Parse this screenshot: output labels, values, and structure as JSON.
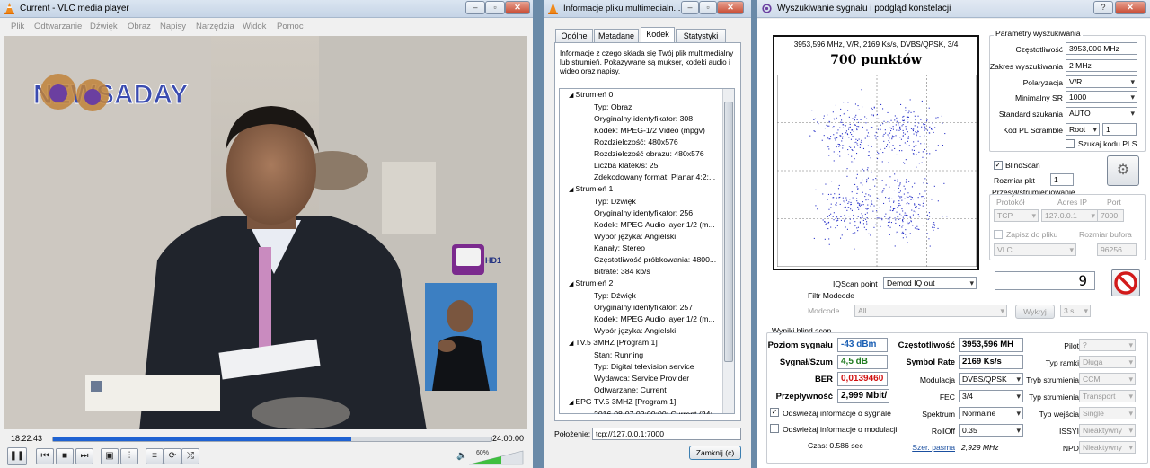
{
  "vlc": {
    "title": "Current - VLC media player",
    "menu": [
      "Plik",
      "Odtwarzanie",
      "Dźwięk",
      "Obraz",
      "Napisy",
      "Narzędzia",
      "Widok",
      "Pomoc"
    ],
    "overlay_logo": "NEWSADAY",
    "channel_logo": "HD1",
    "time_current": "18:22:43",
    "time_total": "24:00:00",
    "progress": 0.68,
    "volume": "60%",
    "volume_level": 0.6
  },
  "info": {
    "title": "Informacje pliku multimedialn...",
    "tabs": [
      "Ogólne",
      "Metadane",
      "Kodek",
      "Statystyki"
    ],
    "active_tab": "Kodek",
    "description": "Informacje z czego składa się Twój plik multimedialny lub strumień. Pokazywane są mukser, kodeki audio i wideo oraz napisy.",
    "tree": [
      {
        "t": "s",
        "text": "Strumień 0"
      },
      {
        "t": "c",
        "text": "Typ: Obraz"
      },
      {
        "t": "c",
        "text": "Oryginalny identyfikator: 308"
      },
      {
        "t": "c",
        "text": "Kodek: MPEG-1/2 Video (mpgv)"
      },
      {
        "t": "c",
        "text": "Rozdzielczość: 480x576"
      },
      {
        "t": "c",
        "text": "Rozdzielczość obrazu: 480x576"
      },
      {
        "t": "c",
        "text": "Liczba klatek/s: 25"
      },
      {
        "t": "c",
        "text": "Zdekodowany format: Planar 4:2:..."
      },
      {
        "t": "s",
        "text": "Strumień 1"
      },
      {
        "t": "c",
        "text": "Typ: Dźwięk"
      },
      {
        "t": "c",
        "text": "Oryginalny identyfikator: 256"
      },
      {
        "t": "c",
        "text": "Kodek: MPEG Audio layer 1/2 (m..."
      },
      {
        "t": "c",
        "text": "Wybór języka: Angielski"
      },
      {
        "t": "c",
        "text": "Kanały: Stereo"
      },
      {
        "t": "c",
        "text": "Częstotliwość próbkowania: 4800..."
      },
      {
        "t": "c",
        "text": "Bitrate: 384 kb/s"
      },
      {
        "t": "s",
        "text": "Strumień 2"
      },
      {
        "t": "c",
        "text": "Typ: Dźwięk"
      },
      {
        "t": "c",
        "text": "Oryginalny identyfikator: 257"
      },
      {
        "t": "c",
        "text": "Kodek: MPEG Audio layer 1/2 (m..."
      },
      {
        "t": "c",
        "text": "Wybór języka: Angielski"
      },
      {
        "t": "s",
        "text": "TV.5 3MHZ [Program 1]"
      },
      {
        "t": "c",
        "text": "Stan: Running"
      },
      {
        "t": "c",
        "text": "Typ: Digital television service"
      },
      {
        "t": "c",
        "text": "Wydawca: Service Provider"
      },
      {
        "t": "c",
        "text": "Odtwarzane: Current"
      },
      {
        "t": "s",
        "text": "EPG TV.5 3MHZ [Program 1]"
      },
      {
        "t": "c",
        "text": "2016-08-07 02:00:00: Current (24:..."
      }
    ],
    "location_label": "Położenie:",
    "location_value": "tcp://127.0.0.1:7000",
    "close_label": "Zamknij (c)"
  },
  "scan": {
    "title": "Wyszukiwanie sygnału i podgląd konstelacji",
    "plot_header": "3953,596 MHz, V/R, 2169 Ks/s, DVBS/QPSK, 3/4",
    "plot_title": "700 punktów",
    "params_group": "Parametry wyszukiwania",
    "freq_label": "Częstotliwość",
    "freq_value": "3953,000 MHz",
    "range_label": "Zakres wyszukiwania",
    "range_value": "2 MHz",
    "pol_label": "Polaryzacja",
    "pol_value": "V/R",
    "minsr_label": "Minimalny SR",
    "minsr_value": "1000",
    "std_label": "Standard szukania",
    "std_value": "AUTO",
    "pl_label": "Kod PL Scramble",
    "pl_value": "Root",
    "pl_num": "1",
    "pls_label": "Szukaj kodu PLS",
    "blind_label": "BlindScan",
    "step_label": "Rozmiar pkt",
    "step_value": "1",
    "stream_group": "Przesył/strumieniowanie",
    "proto_label": "Protokół",
    "ip_label": "Adres IP",
    "port_label": "Port",
    "proto_value": "TCP",
    "ip_value": "127.0.0.1",
    "port_value": "7000",
    "save_label": "Zapisz do pliku",
    "buf_label": "Rozmiar bufora",
    "file_value": "VLC",
    "buf_value": "96256",
    "iq_label": "IQScan point",
    "iq_value": "Demod IQ out",
    "counter": "9",
    "modcode_group": "Filtr Modcode",
    "modcode_label": "Modcode",
    "modcode_value": "All",
    "exclude_label": "Wykryj",
    "sec_value": "3 s",
    "results_group": "Wyniki blind scan",
    "level_label": "Poziom sygnału",
    "level_value": "-43 dBm",
    "snr_label": "Sygnał/Szum",
    "snr_value": "4,5 dB",
    "ber_label": "BER",
    "ber_value": "0,0139460",
    "tput_label": "Przepływność",
    "tput_value": "2,999 Mbit/",
    "rfreq_label": "Częstotliwość",
    "rfreq_value": "3953,596 MH",
    "srate_label": "Symbol Rate",
    "srate_value": "2169 Ks/s",
    "mod_label": "Modulacja",
    "mod_value": "DVBS/QPSK",
    "fec_label": "FEC",
    "fec_value": "3/4",
    "spec_label": "Spektrum",
    "spec_value": "Normalne",
    "rolloff_label": "RollOff",
    "rolloff_value": "0.35",
    "bw_label": "Szer. pasma",
    "bw_value": "2,929 MHz",
    "pilot_label": "Pilot",
    "pilot_value": "?",
    "frame_label": "Typ ramki",
    "frame_value": "Długa",
    "smode_label": "Tryb strumienia",
    "smode_value": "CCM",
    "stype_label": "Typ strumienia",
    "stype_value": "Transport",
    "itype_label": "Typ wejścia",
    "itype_value": "Single",
    "issyi_label": "ISSYI",
    "issyi_value": "Nieaktywny",
    "npd_label": "NPD",
    "npd_value": "Nieaktywny",
    "refresh1_label": "Odświeżaj informacje o sygnale",
    "refresh2_label": "Odświeżaj informacje o modulacji",
    "time_label": "Czas: 0.586 sec",
    "level_color": "#1a5fb4",
    "snr_color": "#1e7a1e",
    "ber_color": "#d01010"
  }
}
